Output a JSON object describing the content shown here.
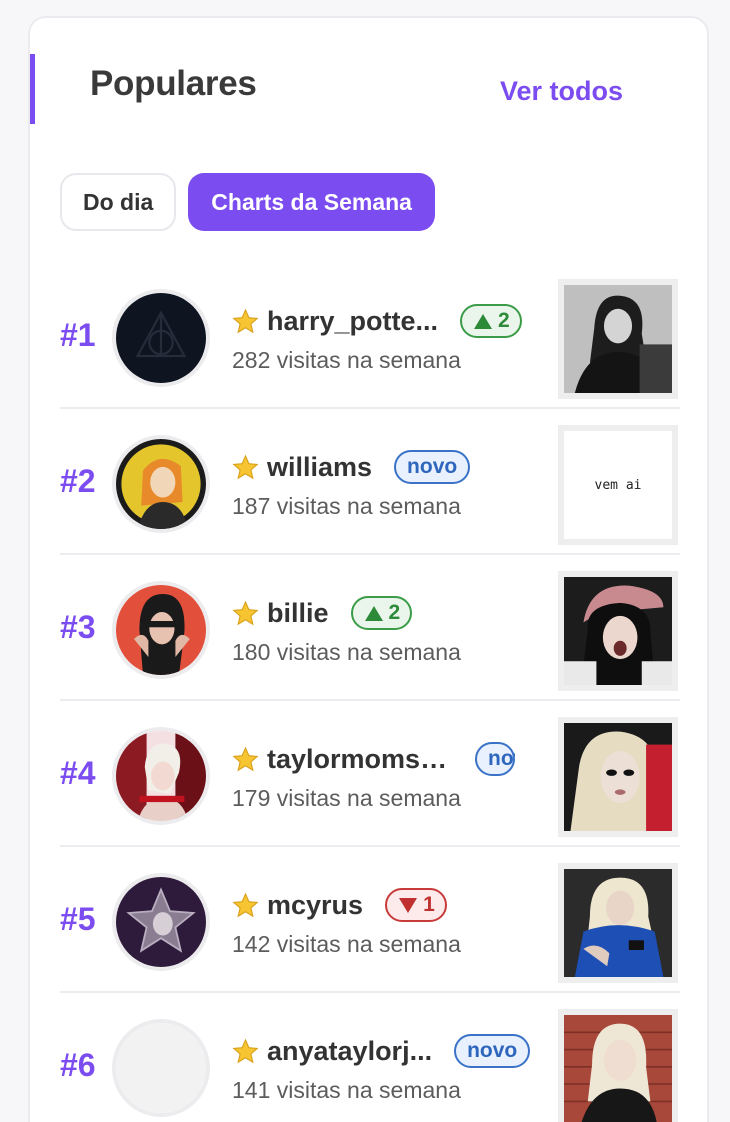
{
  "header": {
    "title": "Populares",
    "see_all": "Ver todos",
    "accent_color": "#7b4df1"
  },
  "tabs": [
    {
      "label": "Do dia",
      "active": false
    },
    {
      "label": "Charts da Semana",
      "active": true
    }
  ],
  "ranking": [
    {
      "rank": "#1",
      "username": "harry_potte...",
      "visits": "282 visitas na semana",
      "badge": {
        "type": "up",
        "label": "2"
      },
      "avatar_icon": "deathly-hallows-icon",
      "thumb_icon": "bw-portrait-photo"
    },
    {
      "rank": "#2",
      "username": "williams",
      "visits": "187 visitas na semana",
      "badge": {
        "type": "new",
        "label": "novo"
      },
      "avatar_icon": "yellow-portrait-avatar",
      "thumb_text": "vem ai"
    },
    {
      "rank": "#3",
      "username": "billie",
      "visits": "180 visitas na semana",
      "badge": {
        "type": "up",
        "label": "2"
      },
      "avatar_icon": "red-portrait-avatar",
      "thumb_icon": "cap-portrait-photo"
    },
    {
      "rank": "#4",
      "username": "taylormomse...",
      "visits": "179 visitas na semana",
      "badge": {
        "type": "new",
        "label": "novo"
      },
      "avatar_icon": "red-edit-avatar",
      "thumb_icon": "blonde-portrait-photo"
    },
    {
      "rank": "#5",
      "username": "mcyrus",
      "visits": "142 visitas na semana",
      "badge": {
        "type": "down",
        "label": "1"
      },
      "avatar_icon": "purple-star-avatar",
      "thumb_icon": "blue-shirt-photo"
    },
    {
      "rank": "#6",
      "username": "anyataylorj...",
      "visits": "141 visitas na semana",
      "badge": {
        "type": "new",
        "label": "novo"
      },
      "avatar_icon": "empty-avatar",
      "thumb_icon": "brick-wall-portrait-photo"
    }
  ]
}
